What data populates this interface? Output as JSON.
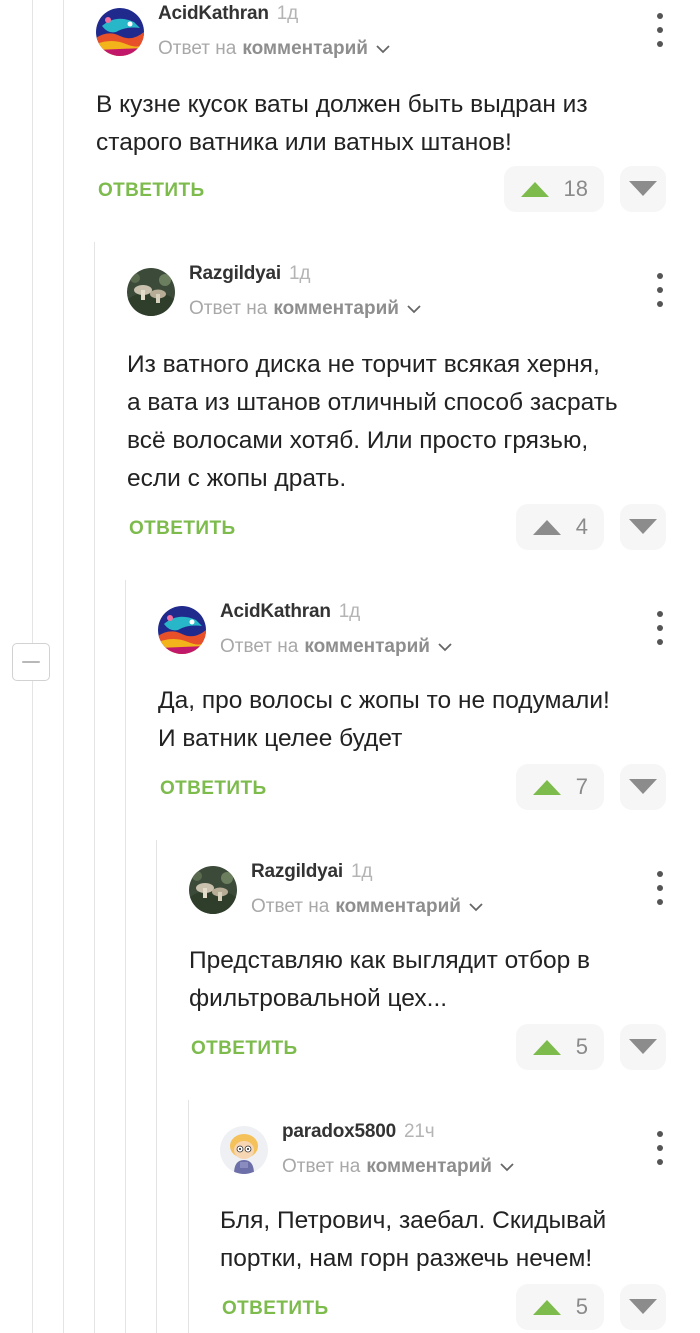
{
  "ui": {
    "reply_prefix": "Ответ на",
    "reply_target": "комментарий",
    "reply_button": "ОТВЕТИТЬ"
  },
  "colors": {
    "accent_green": "#7cbb4c",
    "vote_neutral": "#8a8a8a",
    "vote_arrow_gray": "#8c8c8c"
  },
  "comments": [
    {
      "author": "AcidKathran",
      "time": "1д",
      "avatar_icon": "colorful-bird-avatar",
      "text_lines": [
        "В кузне кусок ваты должен быть выдран из",
        "старого ватника или ватных штанов!"
      ],
      "rating": "18",
      "upvoted": true
    },
    {
      "author": "Razgildyai",
      "time": "1д",
      "avatar_icon": "mushroom-photo-avatar",
      "text_lines": [
        "Из ватного диска не торчит всякая херня,",
        "а вата из штанов отличный способ засрать",
        "всё волосами хотяб. Или просто грязью,",
        "если с жопы драть."
      ],
      "rating": "4",
      "upvoted": false
    },
    {
      "author": "AcidKathran",
      "time": "1д",
      "avatar_icon": "colorful-bird-avatar",
      "text_lines": [
        "Да, про волосы с жопы то не подумали!",
        "И ватник целее будет"
      ],
      "rating": "7",
      "upvoted": true
    },
    {
      "author": "Razgildyai",
      "time": "1д",
      "avatar_icon": "mushroom-photo-avatar",
      "text_lines": [
        "Представляю как выглядит отбор в",
        "фильтровальной цех..."
      ],
      "rating": "5",
      "upvoted": true
    },
    {
      "author": "paradox5800",
      "time": "21ч",
      "avatar_icon": "cartoon-character-avatar",
      "text_lines": [
        "Бля, Петрович, заебал. Скидывай",
        "портки, нам горн разжечь нечем!"
      ],
      "rating": "5",
      "upvoted": true
    }
  ]
}
